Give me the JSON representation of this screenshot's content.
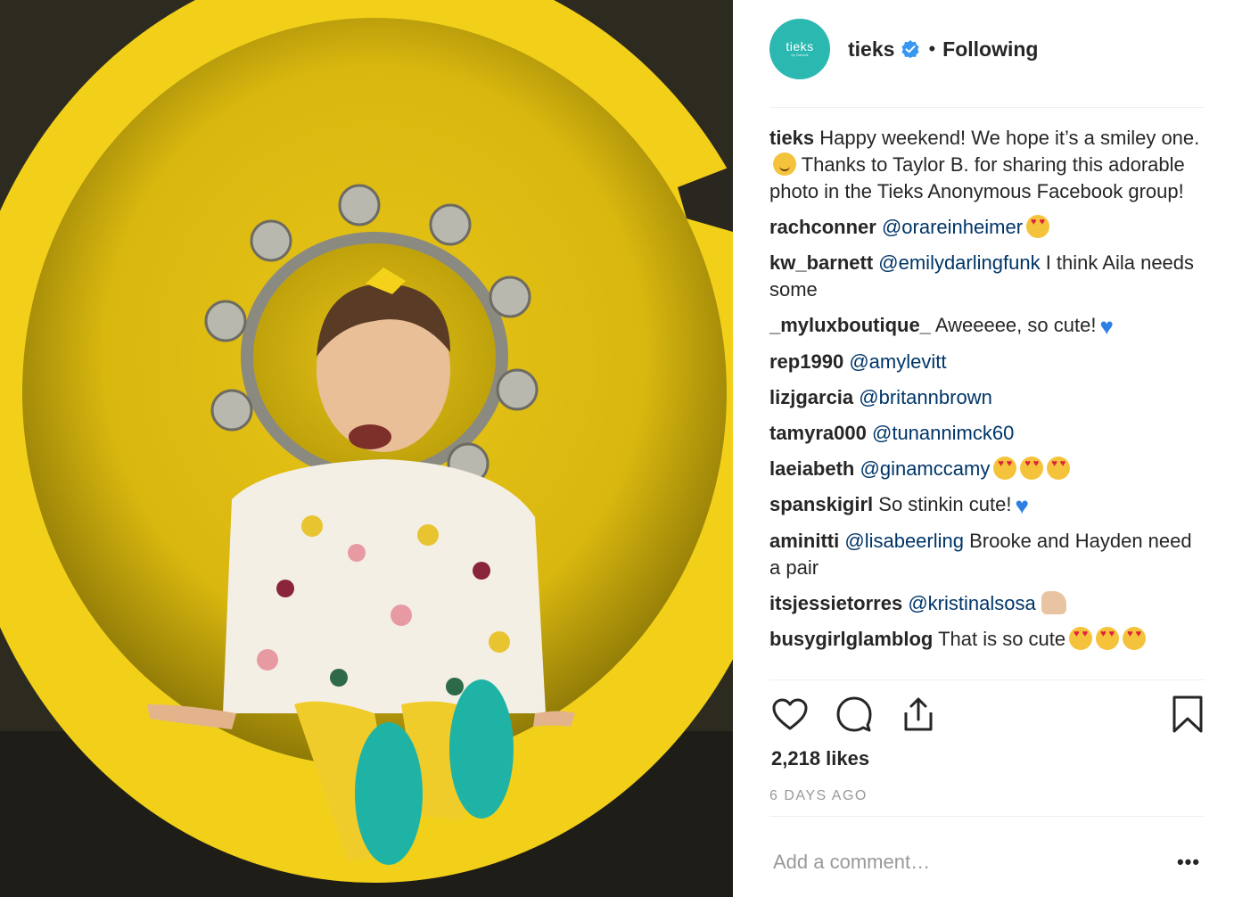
{
  "post": {
    "photo_alt": "Toddler smiling while sitting inside a yellow tractor wheel",
    "account": {
      "avatar_text": "tieks",
      "avatar_subtext": "by Gavrieli",
      "username": "tieks",
      "separator": "•",
      "follow_status": "Following"
    },
    "comments": [
      {
        "user": "tieks",
        "segments": [
          {
            "type": "text",
            "text": "Happy weekend! We hope it’s a smiley one."
          },
          {
            "type": "emoji",
            "name": "smile"
          },
          {
            "type": "text",
            "text": " Thanks to Taylor B. for sharing this adorable photo in the Tieks Anonymous Facebook group!"
          }
        ]
      },
      {
        "user": "rachconner",
        "segments": [
          {
            "type": "mention",
            "text": "@orareinheimer"
          },
          {
            "type": "emoji",
            "name": "heart-eyes"
          }
        ]
      },
      {
        "user": "kw_barnett",
        "segments": [
          {
            "type": "mention",
            "text": "@emilydarlingfunk"
          },
          {
            "type": "text",
            "text": " I think Aila needs some"
          }
        ]
      },
      {
        "user": "_myluxboutique_",
        "segments": [
          {
            "type": "text",
            "text": "Aweeeee, so cute!"
          },
          {
            "type": "emoji",
            "name": "blue-heart"
          }
        ]
      },
      {
        "user": "rep1990",
        "segments": [
          {
            "type": "mention",
            "text": "@amylevitt"
          }
        ]
      },
      {
        "user": "lizjgarcia",
        "segments": [
          {
            "type": "mention",
            "text": "@britannbrown"
          }
        ]
      },
      {
        "user": "tamyra000",
        "segments": [
          {
            "type": "mention",
            "text": "@tunannimck60"
          }
        ]
      },
      {
        "user": "laeiabeth",
        "segments": [
          {
            "type": "mention",
            "text": "@ginamccamy"
          },
          {
            "type": "emoji",
            "name": "heart-eyes"
          },
          {
            "type": "emoji",
            "name": "heart-eyes"
          },
          {
            "type": "emoji",
            "name": "heart-eyes"
          }
        ]
      },
      {
        "user": "spanskigirl",
        "segments": [
          {
            "type": "text",
            "text": "So stinkin cute!"
          },
          {
            "type": "emoji",
            "name": "blue-heart"
          }
        ]
      },
      {
        "user": "aminitti",
        "segments": [
          {
            "type": "mention",
            "text": "@lisabeerling"
          },
          {
            "type": "text",
            "text": " Brooke and Hayden need a pair"
          }
        ]
      },
      {
        "user": "itsjessietorres",
        "segments": [
          {
            "type": "mention",
            "text": "@kristinalsosa"
          },
          {
            "type": "emoji",
            "name": "thumbs-up"
          }
        ]
      },
      {
        "user": "busygirlglamblog",
        "segments": [
          {
            "type": "text",
            "text": "That is so cute"
          },
          {
            "type": "emoji",
            "name": "heart-eyes"
          },
          {
            "type": "emoji",
            "name": "heart-eyes"
          },
          {
            "type": "emoji",
            "name": "heart-eyes"
          }
        ]
      }
    ],
    "actions": {
      "like_icon": "heart-icon",
      "comment_icon": "comment-icon",
      "share_icon": "share-icon",
      "save_icon": "bookmark-icon"
    },
    "likes_text": "2,218 likes",
    "timestamp": "6 DAYS AGO",
    "add_comment_placeholder": "Add a comment…",
    "more_label": "•••"
  },
  "colors": {
    "avatar_bg": "#2bb8b0",
    "verified_badge": "#3897f0",
    "mention": "#003569",
    "wheel_yellow": "#f2d01a",
    "tiek_teal": "#1fb3a6"
  }
}
